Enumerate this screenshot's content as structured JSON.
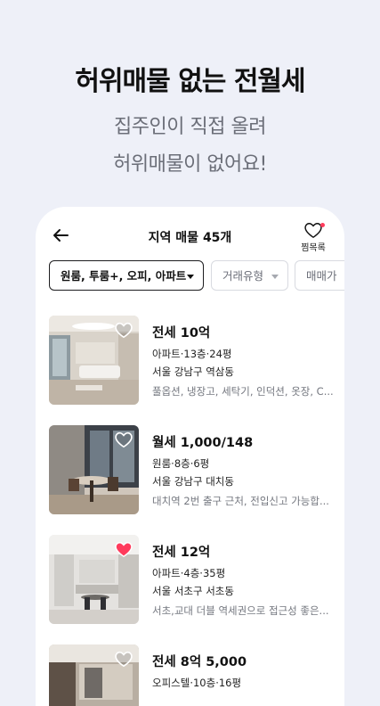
{
  "headline": "허위매물 없는 전월세",
  "subline1": "집주인이 직접 올려",
  "subline2": "허위매물이 없어요!",
  "topbar": {
    "title": "지역 매물 45개",
    "wishlist_label": "찜목록"
  },
  "filters": [
    {
      "label": "원룸, 투룸+, 오피, 아파트",
      "active": true
    },
    {
      "label": "거래유형",
      "active": false
    },
    {
      "label": "매매가",
      "active": false
    }
  ],
  "listings": [
    {
      "price": "전세 10억",
      "meta": "아파트·13층·24평",
      "location": "서울 강남구 역삼동",
      "description": "풀옵션, 냉장고, 세탁기, 인덕션, 옷장, C...",
      "liked": false
    },
    {
      "price": "월세 1,000/148",
      "meta": "원룸·8층·6평",
      "location": "서울 강남구 대치동",
      "description": "대치역 2번 출구 근처, 전입신고 가능합...",
      "liked": false
    },
    {
      "price": "전세 12억",
      "meta": "아파트·4층·35평",
      "location": "서울 서초구 서초동",
      "description": "서초,교대 더블 역세권으로 접근성 좋은...",
      "liked": true
    },
    {
      "price": "전세 8억 5,000",
      "meta": "오피스텔·10층·16평",
      "location": "",
      "description": "",
      "liked": false
    }
  ],
  "colors": {
    "background": "#eef0f8",
    "accent": "#ff3b5c",
    "text": "#111111",
    "muted": "#74777f"
  }
}
